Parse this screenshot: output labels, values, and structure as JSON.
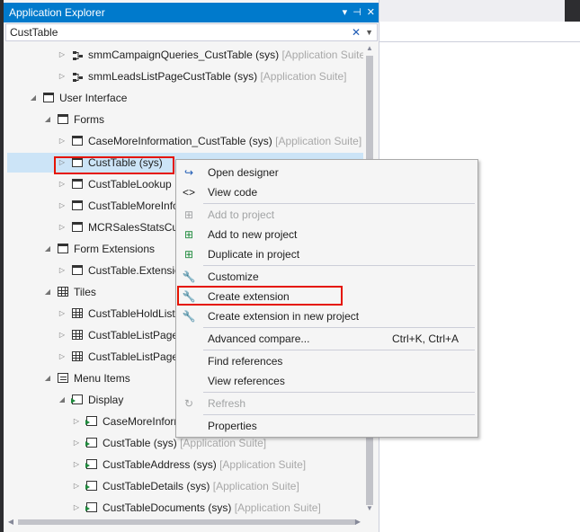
{
  "panel": {
    "title": "Application Explorer",
    "controls": [
      "▾",
      "⊣",
      "✕"
    ],
    "search_value": "CustTable",
    "search_clear": "✕",
    "search_dropdown": "▼"
  },
  "tree": [
    {
      "indent": 3,
      "arrow": "▷",
      "icon": "query",
      "text": "smmCampaignQueries_CustTable",
      "tag": "(sys)",
      "model": "[Application Suite]"
    },
    {
      "indent": 3,
      "arrow": "▷",
      "icon": "query",
      "text": "smmLeadsListPageCustTable",
      "tag": "(sys)",
      "model": "[Application Suite]"
    },
    {
      "indent": 1,
      "arrow": "◢",
      "icon": "ui",
      "text": "User Interface",
      "tag": "",
      "model": ""
    },
    {
      "indent": 2,
      "arrow": "◢",
      "icon": "form",
      "text": "Forms",
      "tag": "",
      "model": ""
    },
    {
      "indent": 3,
      "arrow": "▷",
      "icon": "form",
      "text": "CaseMoreInformation_CustTable",
      "tag": "(sys)",
      "model": "[Application Suite]"
    },
    {
      "indent": 3,
      "arrow": "▷",
      "icon": "form",
      "text": "CustTable",
      "tag": "(sys)",
      "model": "",
      "selected": true
    },
    {
      "indent": 3,
      "arrow": "▷",
      "icon": "form",
      "text": "CustTableLookup",
      "tag": "",
      "model": ""
    },
    {
      "indent": 3,
      "arrow": "▷",
      "icon": "form",
      "text": "CustTableMoreInfo",
      "tag": "",
      "model": ""
    },
    {
      "indent": 3,
      "arrow": "▷",
      "icon": "form",
      "text": "MCRSalesStatsCust",
      "tag": "",
      "model": ""
    },
    {
      "indent": 2,
      "arrow": "◢",
      "icon": "ext",
      "text": "Form Extensions",
      "tag": "",
      "model": ""
    },
    {
      "indent": 3,
      "arrow": "▷",
      "icon": "ext",
      "text": "CustTable.Extension",
      "tag": "",
      "model": ""
    },
    {
      "indent": 2,
      "arrow": "◢",
      "icon": "tile",
      "text": "Tiles",
      "tag": "",
      "model": ""
    },
    {
      "indent": 3,
      "arrow": "▷",
      "icon": "tile",
      "text": "CustTableHoldList",
      "tag": "",
      "model": ""
    },
    {
      "indent": 3,
      "arrow": "▷",
      "icon": "tile",
      "text": "CustTableListPage",
      "tag": "",
      "model": ""
    },
    {
      "indent": 3,
      "arrow": "▷",
      "icon": "tile",
      "text": "CustTableListPage",
      "tag": "",
      "model": ""
    },
    {
      "indent": 2,
      "arrow": "◢",
      "icon": "menu",
      "text": "Menu Items",
      "tag": "",
      "model": ""
    },
    {
      "indent": 3,
      "arrow": "◢",
      "icon": "display",
      "text": "Display",
      "tag": "",
      "model": ""
    },
    {
      "indent": 4,
      "arrow": "▷",
      "icon": "mi",
      "text": "CaseMoreInformation",
      "tag": "",
      "model": ""
    },
    {
      "indent": 4,
      "arrow": "▷",
      "icon": "mi",
      "text": "CustTable",
      "tag": "(sys)",
      "model": "[Application Suite]"
    },
    {
      "indent": 4,
      "arrow": "▷",
      "icon": "mi",
      "text": "CustTableAddress",
      "tag": "(sys)",
      "model": "[Application Suite]"
    },
    {
      "indent": 4,
      "arrow": "▷",
      "icon": "mi",
      "text": "CustTableDetails",
      "tag": "(sys)",
      "model": "[Application Suite]"
    },
    {
      "indent": 4,
      "arrow": "▷",
      "icon": "mi",
      "text": "CustTableDocuments",
      "tag": "(sys)",
      "model": "[Application Suite]"
    }
  ],
  "context_menu": [
    {
      "icon": "↪",
      "icon_name": "open-designer-icon",
      "label": "Open designer",
      "shortcut": "",
      "disabled": false,
      "sep_after": false
    },
    {
      "icon": "<>",
      "icon_name": "view-code-icon",
      "label": "View code",
      "shortcut": "",
      "disabled": false,
      "sep_after": true
    },
    {
      "icon": "⊞",
      "icon_name": "add-to-project-icon",
      "label": "Add to project",
      "shortcut": "",
      "disabled": true,
      "sep_after": false
    },
    {
      "icon": "⊞",
      "icon_name": "add-to-new-project-icon",
      "label": "Add to new project",
      "shortcut": "",
      "disabled": false,
      "sep_after": false
    },
    {
      "icon": "⊞",
      "icon_name": "duplicate-in-project-icon",
      "label": "Duplicate in project",
      "shortcut": "",
      "disabled": false,
      "sep_after": true
    },
    {
      "icon": "🔧",
      "icon_name": "customize-icon",
      "label": "Customize",
      "shortcut": "",
      "disabled": false,
      "sep_after": false
    },
    {
      "icon": "🔧",
      "icon_name": "create-extension-icon",
      "label": "Create extension",
      "shortcut": "",
      "disabled": false,
      "sep_after": false,
      "highlight": true
    },
    {
      "icon": "🔧",
      "icon_name": "create-extension-new-project-icon",
      "label": "Create extension in new project",
      "shortcut": "",
      "disabled": false,
      "sep_after": true
    },
    {
      "icon": "",
      "icon_name": "advanced-compare-icon",
      "label": "Advanced compare...",
      "shortcut": "Ctrl+K, Ctrl+A",
      "disabled": false,
      "sep_after": true
    },
    {
      "icon": "",
      "icon_name": "find-references-icon",
      "label": "Find references",
      "shortcut": "",
      "disabled": false,
      "sep_after": false
    },
    {
      "icon": "",
      "icon_name": "view-references-icon",
      "label": "View references",
      "shortcut": "",
      "disabled": false,
      "sep_after": true
    },
    {
      "icon": "↻",
      "icon_name": "refresh-icon",
      "label": "Refresh",
      "shortcut": "",
      "disabled": true,
      "sep_after": true
    },
    {
      "icon": "",
      "icon_name": "properties-icon",
      "label": "Properties",
      "shortcut": "",
      "disabled": false,
      "sep_after": false
    }
  ],
  "colors": {
    "title_bar": "#007acc",
    "highlight_box": "#e51400",
    "selected_row": "#cce4f7",
    "model_text": "#a8a8a8"
  }
}
